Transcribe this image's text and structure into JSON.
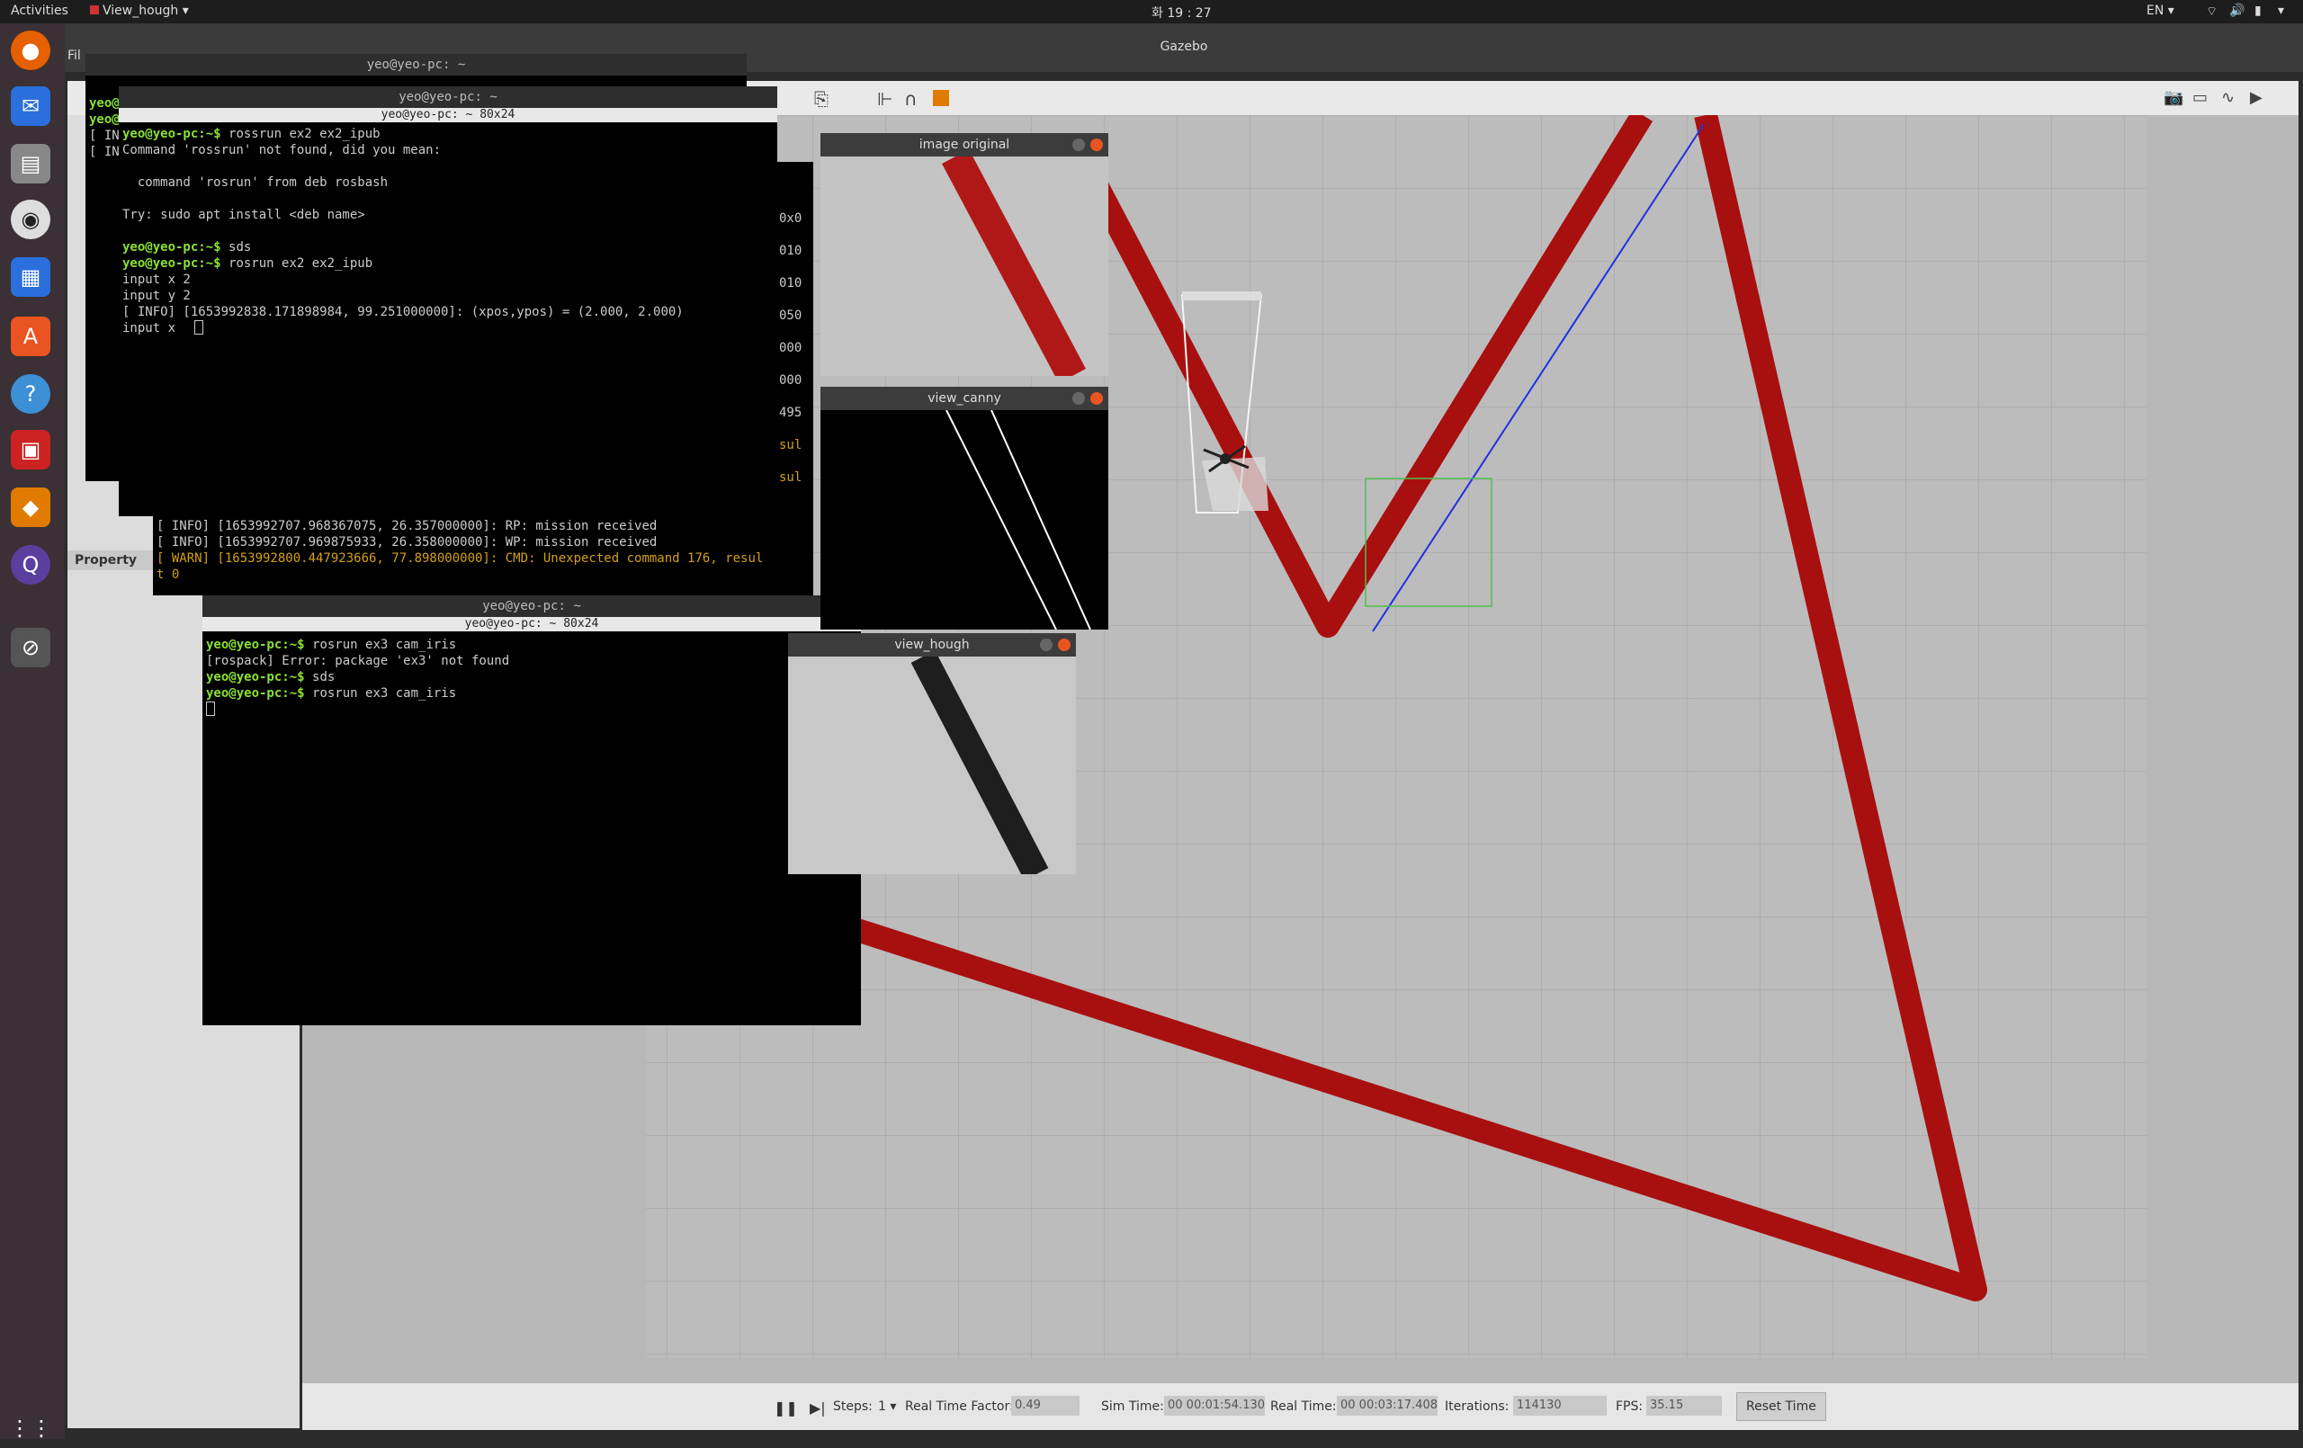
{
  "topbar": {
    "activities": "Activities",
    "app": "View_hough",
    "clock": "화 19 : 27",
    "lang": "EN"
  },
  "gazebo": {
    "title": "Gazebo",
    "menu_file": "Fil",
    "panel_label": "Property",
    "sim": {
      "steps_label": "Steps:",
      "steps_value": "1",
      "rtf_label": "Real Time Factor:",
      "rtf_value": "0.49",
      "sim_time_label": "Sim Time:",
      "sim_time_value": "00 00:01:54.130",
      "real_time_label": "Real Time:",
      "real_time_value": "00 00:03:17.408",
      "iterations_label": "Iterations:",
      "iterations_value": "114130",
      "fps_label": "FPS:",
      "fps_value": "35.15",
      "reset_label": "Reset Time"
    }
  },
  "terminal_back": {
    "title": "yeo@yeo-pc: ~",
    "lines": [
      "yeo@",
      "yeo@",
      "[ IN",
      "[ IN"
    ]
  },
  "terminal_ex2": {
    "title": "yeo@yeo-pc: ~",
    "subtitle": "yeo@yeo-pc: ~ 80x24",
    "lines": [
      {
        "p": "yeo@yeo-pc:~$ ",
        "t": "rossrun ex2 ex2_ipub"
      },
      {
        "p": "",
        "t": "Command 'rossrun' not found, did you mean:"
      },
      {
        "p": "",
        "t": ""
      },
      {
        "p": "",
        "t": "  command 'rosrun' from deb rosbash"
      },
      {
        "p": "",
        "t": ""
      },
      {
        "p": "",
        "t": "Try: sudo apt install <deb name>"
      },
      {
        "p": "",
        "t": ""
      },
      {
        "p": "yeo@yeo-pc:~$ ",
        "t": "sds"
      },
      {
        "p": "yeo@yeo-pc:~$ ",
        "t": "rosrun ex2 ex2_ipub"
      },
      {
        "p": "",
        "t": "input x 2"
      },
      {
        "p": "",
        "t": "input y 2"
      },
      {
        "p": "",
        "t": "[ INFO] [1653992838.171898984, 99.251000000]: (xpos,ypos) = (2.000, 2.000)"
      },
      {
        "p": "",
        "t": "input x "
      }
    ]
  },
  "terminal_mid": {
    "right_fragments": [
      "0x0",
      "010",
      "010",
      "050",
      "000",
      "000",
      "495",
      "sul",
      "sul"
    ],
    "lines": [
      {
        "c": "info",
        "t": "[ INFO] [1653992707.968367075, 26.357000000]: RP: mission received"
      },
      {
        "c": "info",
        "t": "[ INFO] [1653992707.969875933, 26.358000000]: WP: mission received"
      },
      {
        "c": "warn",
        "t": "[ WARN] [1653992800.447923666, 77.898000000]: CMD: Unexpected command 176, resul"
      },
      {
        "c": "warn",
        "t": "t 0"
      }
    ]
  },
  "terminal_ex3": {
    "title": "yeo@yeo-pc: ~",
    "subtitle": "yeo@yeo-pc: ~ 80x24",
    "lines": [
      {
        "p": "yeo@yeo-pc:~$ ",
        "t": "rosrun ex3 cam_iris"
      },
      {
        "p": "",
        "t": "[rospack] Error: package 'ex3' not found"
      },
      {
        "p": "yeo@yeo-pc:~$ ",
        "t": "sds"
      },
      {
        "p": "yeo@yeo-pc:~$ ",
        "t": "rosrun ex3 cam_iris"
      }
    ]
  },
  "windows": {
    "image_original": "image original",
    "view_canny": "view_canny",
    "view_hough": "view_hough"
  },
  "colors": {
    "accent": "#e95420",
    "prompt": "#8ae234",
    "track": "#a80f0f"
  }
}
